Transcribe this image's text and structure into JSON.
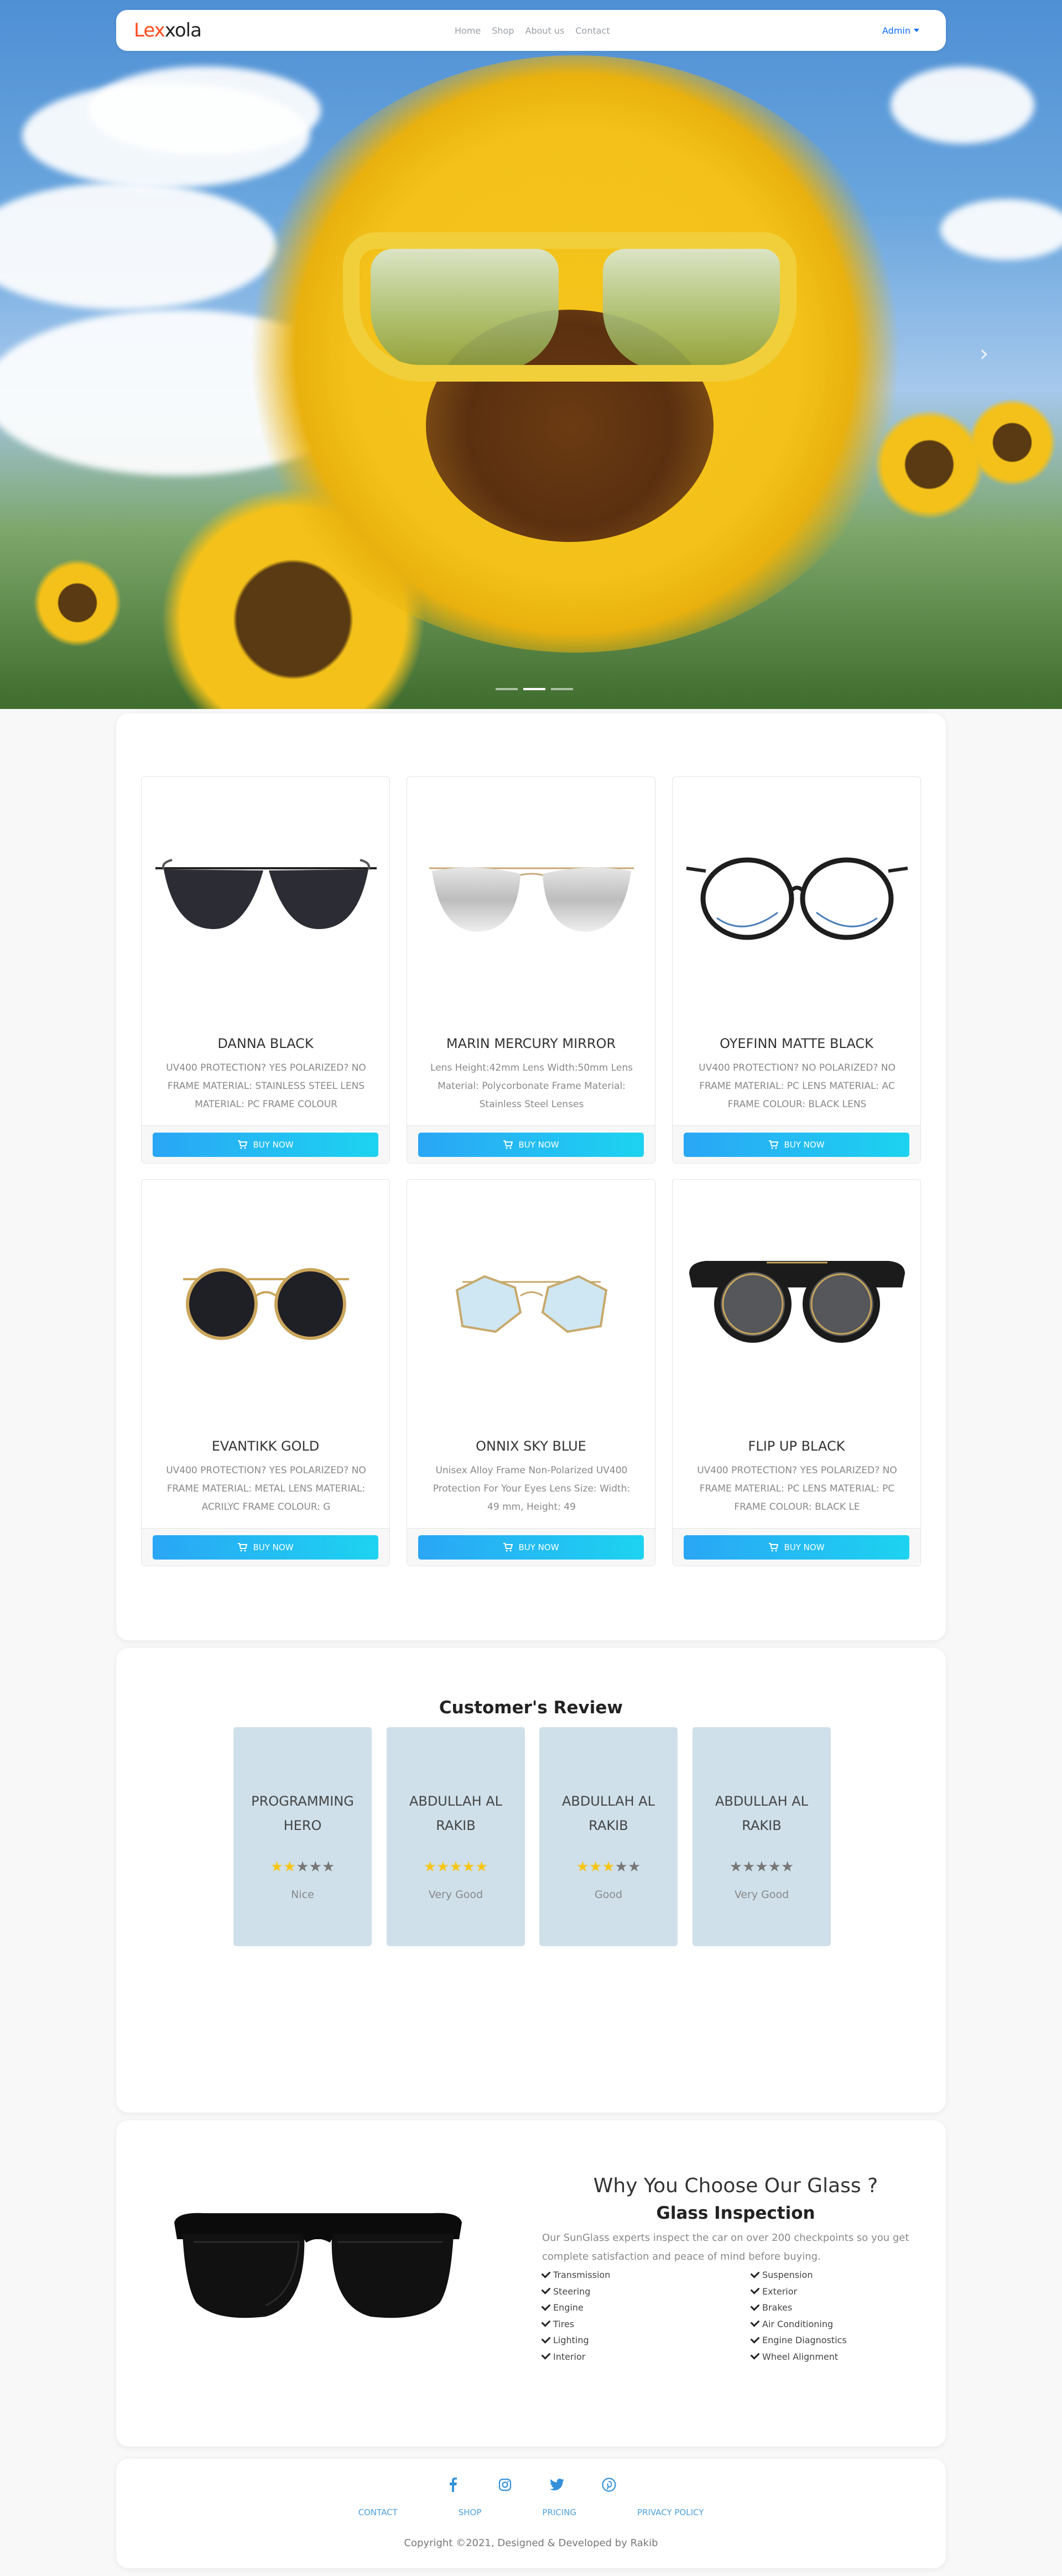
{
  "nav": {
    "logo_part1": "Lex",
    "logo_part2": "xola",
    "links": [
      "Home",
      "Shop",
      "About us",
      "Contact"
    ],
    "admin_label": "Admin"
  },
  "products": [
    {
      "name": "DANNA BLACK",
      "desc": "UV400 PROTECTION? YES POLARIZED? NO FRAME MATERIAL: STAINLESS STEEL LENS MATERIAL: PC FRAME COLOUR",
      "button": "BUY NOW"
    },
    {
      "name": "MARIN MERCURY MIRROR",
      "desc": "Lens Height:42mm Lens Width:50mm Lens Material: Polycorbonate Frame Material: Stainless Steel Lenses",
      "button": "BUY NOW"
    },
    {
      "name": "OYEFINN MATTE BLACK",
      "desc": "UV400 PROTECTION? NO POLARIZED? NO FRAME MATERIAL: PC LENS MATERIAL: AC FRAME COLOUR: BLACK LENS",
      "button": "BUY NOW"
    },
    {
      "name": "EVANTIKK GOLD",
      "desc": "UV400 PROTECTION? YES POLARIZED? NO FRAME MATERIAL: METAL LENS MATERIAL: ACRILYC FRAME COLOUR: G",
      "button": "BUY NOW"
    },
    {
      "name": "ONNIX SKY BLUE",
      "desc": "Unisex Alloy Frame Non-Polarized UV400 Protection For Your Eyes Lens Size: Width: 49 mm, Height: 49",
      "button": "BUY NOW"
    },
    {
      "name": "FLIP UP BLACK",
      "desc": "UV400 PROTECTION? YES POLARIZED? NO FRAME MATERIAL: PC LENS MATERIAL: PC FRAME COLOUR: BLACK LE",
      "button": "BUY NOW"
    }
  ],
  "reviews": {
    "title": "Customer's Review",
    "items": [
      {
        "name": "PROGRAMMING HERO",
        "rating": 2,
        "comment": "Nice"
      },
      {
        "name": "ABDULLAH AL RAKIB",
        "rating": 5,
        "comment": "Very Good"
      },
      {
        "name": "ABDULLAH AL RAKIB",
        "rating": 3,
        "comment": "Good"
      },
      {
        "name": "ABDULLAH AL RAKIB",
        "rating": 0,
        "comment": "Very Good"
      }
    ]
  },
  "why": {
    "title": "Why You Choose Our Glass ?",
    "subtitle": "Glass Inspection",
    "desc": "Our SunGlass experts inspect the car on over 200 checkpoints so you get complete satisfaction and peace of mind before buying.",
    "features_left": [
      "Transmission",
      "Steering",
      "Engine",
      "Tires",
      "Lighting",
      "Interior"
    ],
    "features_right": [
      "Suspension",
      "Exterior",
      "Brakes",
      "Air Conditioning",
      "Engine Diagnostics",
      "Wheel Alignment"
    ]
  },
  "footer": {
    "links": [
      "CONTACT",
      "SHOP",
      "PRICING",
      "PRIVACY POLICY"
    ],
    "copyright": "Copyright ©2021, Designed & Developed by Rakib"
  },
  "colors": {
    "accent": "#0d6efd",
    "logo_orange": "#ff4c1e",
    "button_start": "#2aa6f5",
    "button_end": "#1dd3f0",
    "review_card": "#cfe0ea",
    "star_on": "#f5c518"
  }
}
